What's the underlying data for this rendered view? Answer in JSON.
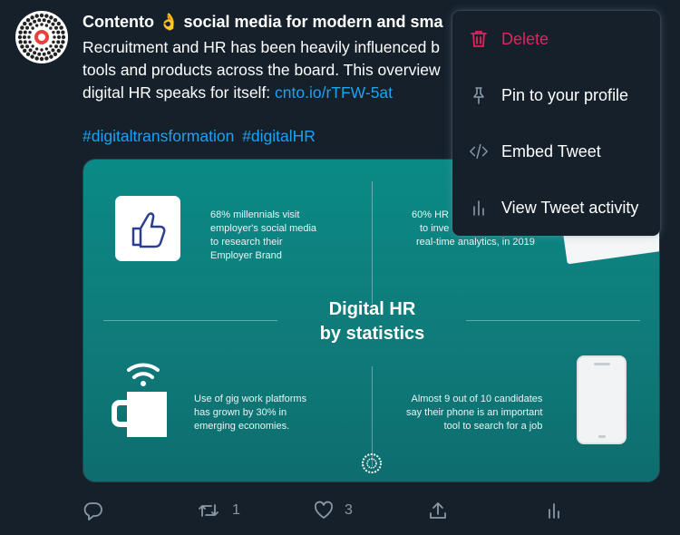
{
  "tweet": {
    "author": "Contento",
    "author_emoji": "👌",
    "header_rest": "social media for modern and sma",
    "text_lines": [
      "Recruitment and HR has been heavily influenced b",
      "tools and products across the board. This overview",
      "digital HR speaks for itself: "
    ],
    "link": "cnto.io/rTFW-5at",
    "hashtags": [
      "#digitaltransformation",
      "#digitalHR"
    ]
  },
  "media": {
    "title_line1": "Digital HR",
    "title_line2": "by statistics",
    "stat1": [
      "68% millennials visit",
      "employer's social media",
      "to research their",
      "Employer Brand"
    ],
    "stat2": [
      "60% HR",
      "to inve",
      "real-time analytics, in 2019"
    ],
    "stat3": [
      "Use of gig work platforms",
      "has grown by 30% in",
      "emerging economies."
    ],
    "stat4": [
      "Almost 9 out of 10 candidates",
      "say their phone is an important",
      "tool to search for a job"
    ]
  },
  "actions": {
    "reply_icon": "reply-icon",
    "retweet_count": "1",
    "like_count": "3",
    "share_icon": "share-icon",
    "analytics_icon": "analytics-icon"
  },
  "menu": {
    "items": [
      {
        "label": "Delete",
        "icon": "trash-icon"
      },
      {
        "label": "Pin to your profile",
        "icon": "pin-icon"
      },
      {
        "label": "Embed Tweet",
        "icon": "code-icon"
      },
      {
        "label": "View Tweet activity",
        "icon": "analytics-icon"
      }
    ]
  },
  "colors": {
    "background": "#15202b",
    "link": "#1da1f2",
    "danger": "#e0245e",
    "muted": "#8899a6",
    "media_teal": "#0f7b7a"
  }
}
